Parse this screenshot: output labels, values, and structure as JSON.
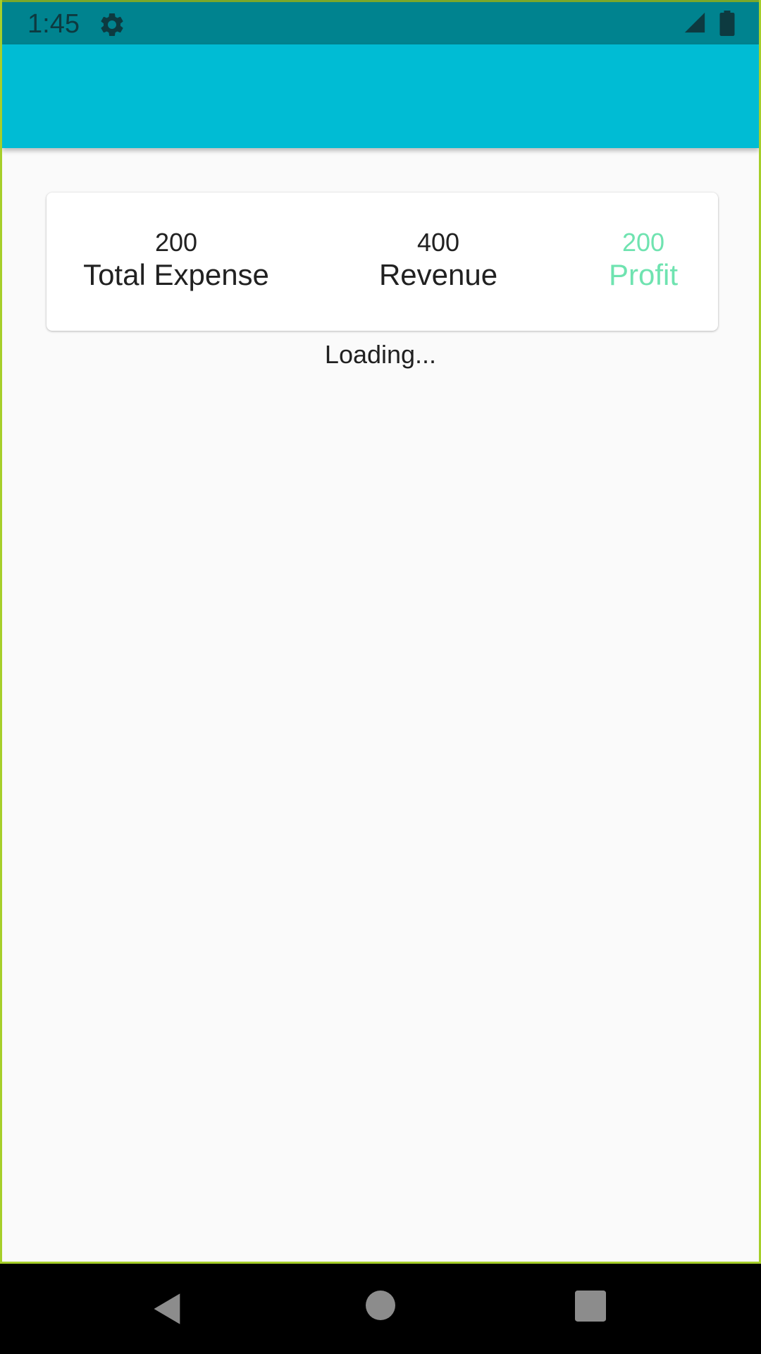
{
  "status_bar": {
    "time": "1:45",
    "icons": [
      "gear-icon",
      "signal-icon",
      "battery-icon"
    ]
  },
  "summary": {
    "expense": {
      "value": "200",
      "label": "Total Expense"
    },
    "revenue": {
      "value": "400",
      "label": "Revenue"
    },
    "profit": {
      "value": "200",
      "label": "Profit",
      "color": "#6fe3b0"
    }
  },
  "loading_text": "Loading...",
  "nav_bar": {
    "icons": [
      "back-icon",
      "home-icon",
      "recents-icon"
    ]
  },
  "colors": {
    "app_bar": "#00bcd4",
    "status_bar": "#00838f",
    "background": "#fafafa",
    "profit": "#6fe3b0"
  }
}
